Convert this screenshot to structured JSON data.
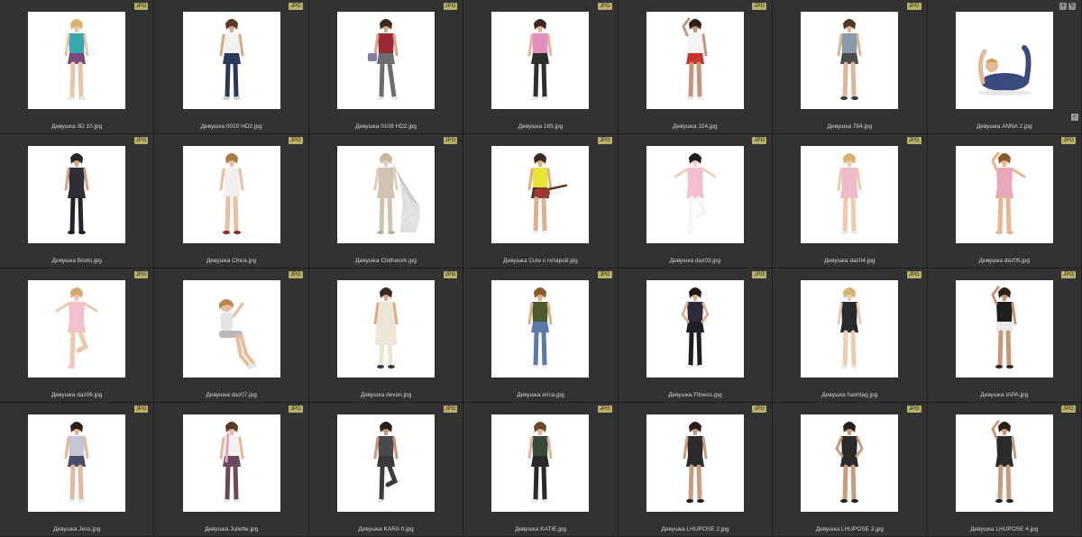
{
  "badge_label": "JPG",
  "icons": {
    "select": "select-icon",
    "pencil": "pencil-icon",
    "check": "check-icon"
  },
  "colors": {
    "cell_bg": "#323232",
    "badge_bg": "#b9b06a",
    "label": "#d4d4d4"
  },
  "items": [
    {
      "name": "Девушка 3D 10.jpg",
      "figure": {
        "skin": "#e8c7a8",
        "hair": "#d9b574",
        "top": "#3aa7b0",
        "bottom": "#7a4a7a",
        "legs": "#e8c7a8",
        "shoes": "#e6e6e6",
        "pose": "stand"
      }
    },
    {
      "name": "Девушка 0010 HD2.jpg",
      "figure": {
        "skin": "#d8a889",
        "hair": "#5a3a26",
        "top": "#f2f2f2",
        "bottom": "#2b3a5a",
        "legs": "#2b3a5a",
        "shoes": "#cfcfcf",
        "pose": "stand"
      }
    },
    {
      "name": "Девушка 0108 HD2.jpg",
      "figure": {
        "skin": "#d6a988",
        "hair": "#3b2a1f",
        "top": "#9a2a36",
        "bottom": "#6d6d6d",
        "legs": "#6d6d6d",
        "shoes": "#e6e6e6",
        "pose": "walk",
        "bag": "#8a7aa6"
      }
    },
    {
      "name": "Девушка 165.jpg",
      "figure": {
        "skin": "#e2b89a",
        "hair": "#3a2a20",
        "top": "#e48ec0",
        "bottom": "#2f2f2f",
        "legs": "#2f2f2f",
        "shoes": "#eaeaea",
        "pose": "stand"
      }
    },
    {
      "name": "Девушка 324.jpg",
      "figure": {
        "skin": "#c69478",
        "hair": "#2a1f18",
        "top": "#f4f4f4",
        "bottom": "#c8342c",
        "legs": "#c69478",
        "shoes": "#e9e9e9",
        "pose": "hand-head"
      }
    },
    {
      "name": "Девушка 784.jpg",
      "figure": {
        "skin": "#dcb59a",
        "hair": "#4a3a2a",
        "top": "#8a9aa8",
        "bottom": "#4a4a4a",
        "legs": "#dcb59a",
        "shoes": "#3a3a3a",
        "pose": "stand"
      }
    },
    {
      "name": "Девушка ANNA 2.jpg",
      "figure": {
        "skin": "#e3b896",
        "hair": "#c9a05a",
        "top": "#3a4a7a",
        "bottom": "#3a4a7a",
        "legs": "#3a4a7a",
        "shoes": "#e3b896",
        "pose": "yoga"
      }
    },
    {
      "name": "Девушка Boots.jpg",
      "figure": {
        "skin": "#d2a587",
        "hair": "#262626",
        "top": "#2e2f38",
        "bottom": "#2e2f38",
        "legs": "#24252a",
        "shoes": "#1d1d1d",
        "pose": "stand"
      }
    },
    {
      "name": "Девушка Chica.jpg",
      "figure": {
        "skin": "#e6c0a4",
        "hair": "#a87a4a",
        "top": "#f0f0f0",
        "bottom": "#f0f0f0",
        "legs": "#e6c0a4",
        "shoes": "#8a2a2a",
        "pose": "stand"
      }
    },
    {
      "name": "Девушка Clothwork.jpg",
      "figure": {
        "skin": "#e4cdb6",
        "hair": "#c8b89a",
        "top": "#cfc2b2",
        "bottom": "#cfc2b2",
        "legs": "#cfc2b2",
        "shoes": "#b8b0a0",
        "pose": "wire"
      }
    },
    {
      "name": "Девушка Cute с гитарой.jpg",
      "figure": {
        "skin": "#e0b08e",
        "hair": "#3a2a20",
        "top": "#e8e436",
        "bottom": "#3a3a3a",
        "legs": "#e0b08e",
        "shoes": "#f2f2f2",
        "pose": "guitar"
      }
    },
    {
      "name": "Девушка daz03.jpg",
      "figure": {
        "skin": "#efd0bd",
        "hair": "#1e1e1e",
        "top": "#f3bfd0",
        "bottom": "#f3bfd0",
        "legs": "#f6f6f6",
        "shoes": "#f6f6f6",
        "pose": "dance"
      }
    },
    {
      "name": "Девушка daz04.jpg",
      "figure": {
        "skin": "#efc9ad",
        "hair": "#d9b06a",
        "top": "#efb9cc",
        "bottom": "#efb9cc",
        "legs": "#efc9ad",
        "shoes": "#e9e9e9",
        "pose": "stand"
      }
    },
    {
      "name": "Девушка daz05.jpg",
      "figure": {
        "skin": "#e7b590",
        "hair": "#8a5a2a",
        "top": "#e8a8b8",
        "bottom": "#e8a8b8",
        "legs": "#e7b590",
        "shoes": "#e7b590",
        "pose": "arm-up"
      }
    },
    {
      "name": "Девушка daz06.jpg",
      "figure": {
        "skin": "#efc7ab",
        "hair": "#d0a868",
        "top": "#f1c0cb",
        "bottom": "#f1c0cb",
        "legs": "#efc7ab",
        "shoes": "#f1c0cb",
        "pose": "ballet"
      }
    },
    {
      "name": "Девушка daz07.jpg",
      "figure": {
        "skin": "#e6bb9c",
        "hair": "#b8864e",
        "top": "#e4e4e4",
        "bottom": "#b9b9b9",
        "legs": "#e6bb9c",
        "shoes": "#e8e8e8",
        "pose": "sit"
      }
    },
    {
      "name": "Девушка devon.jpg",
      "figure": {
        "skin": "#d8ab8a",
        "hair": "#3a2a20",
        "top": "#ece6d6",
        "bottom": "#ece6d6",
        "legs": "#ece6d6",
        "shoes": "#3a3a3a",
        "pose": "coat"
      }
    },
    {
      "name": "Девушка erica.jpg",
      "figure": {
        "skin": "#dcae8c",
        "hair": "#8a5a2a",
        "top": "#4a5a2a",
        "bottom": "#5a7aa8",
        "legs": "#5a7aa8",
        "shoes": "#f0f0f0",
        "pose": "stand"
      }
    },
    {
      "name": "Девушка Fitness.jpg",
      "figure": {
        "skin": "#dfb190",
        "hair": "#1f1a18",
        "top": "#2a2a3a",
        "bottom": "#1e1e24",
        "legs": "#1e1e24",
        "shoes": "#f0f0f0",
        "pose": "hands-hip"
      }
    },
    {
      "name": "Девушка hashtag.jpg",
      "figure": {
        "skin": "#eccbb0",
        "hair": "#d8b070",
        "top": "#2a2a2a",
        "bottom": "#2a2a2a",
        "legs": "#eccbb0",
        "shoes": "#e9e9e9",
        "pose": "stand"
      }
    },
    {
      "name": "Девушка IAPA.jpg",
      "figure": {
        "skin": "#c79676",
        "hair": "#2a1f18",
        "top": "#1e1e1e",
        "bottom": "#e8e8e8",
        "legs": "#c79676",
        "shoes": "#2a2a2a",
        "pose": "hand-head"
      }
    },
    {
      "name": "Девушка Jess.jpg",
      "figure": {
        "skin": "#e3b79a",
        "hair": "#2a1f18",
        "top": "#c5c5d5",
        "bottom": "#4a4a6a",
        "legs": "#e3b79a",
        "shoes": "#f0f0f0",
        "pose": "stand"
      }
    },
    {
      "name": "Девушка Juliette.jpg",
      "figure": {
        "skin": "#e4b898",
        "hair": "#5a3a26",
        "top": "#f2f2f2",
        "bottom": "#6a4a5a",
        "legs": "#6a4a5a",
        "shoes": "#eaeaea",
        "pose": "scarf"
      }
    },
    {
      "name": "Девушка KARA 0.jpg",
      "figure": {
        "skin": "#c8957a",
        "hair": "#2a1f18",
        "top": "#4a4a4a",
        "bottom": "#3a3a3a",
        "legs": "#3a3a3a",
        "shoes": "#e9e9e9",
        "pose": "one-leg"
      }
    },
    {
      "name": "Девушка KATIE.jpg",
      "figure": {
        "skin": "#e2b596",
        "hair": "#6a4a2a",
        "top": "#3a4a3a",
        "bottom": "#2a2a2a",
        "legs": "#2a2a2a",
        "shoes": "#eaeaea",
        "pose": "stand"
      }
    },
    {
      "name": "Девушка LHUPOSE 2.jpg",
      "figure": {
        "skin": "#c89a7e",
        "hair": "#2a1f18",
        "top": "#2a2a2a",
        "bottom": "#2a2a2a",
        "legs": "#c89a7e",
        "shoes": "#1f1f1f",
        "pose": "stand"
      }
    },
    {
      "name": "Девушка LHUPOSE 3.jpg",
      "figure": {
        "skin": "#c89a7e",
        "hair": "#2a1f18",
        "top": "#2a2a2a",
        "bottom": "#2a2a2a",
        "legs": "#c89a7e",
        "shoes": "#1f1f1f",
        "pose": "hands-hip"
      }
    },
    {
      "name": "Девушка LHUPOSE 4.jpg",
      "figure": {
        "skin": "#c89a7e",
        "hair": "#2a1f18",
        "top": "#2a2a2a",
        "bottom": "#2a2a2a",
        "legs": "#c89a7e",
        "shoes": "#1f1f1f",
        "pose": "hand-head"
      }
    }
  ]
}
